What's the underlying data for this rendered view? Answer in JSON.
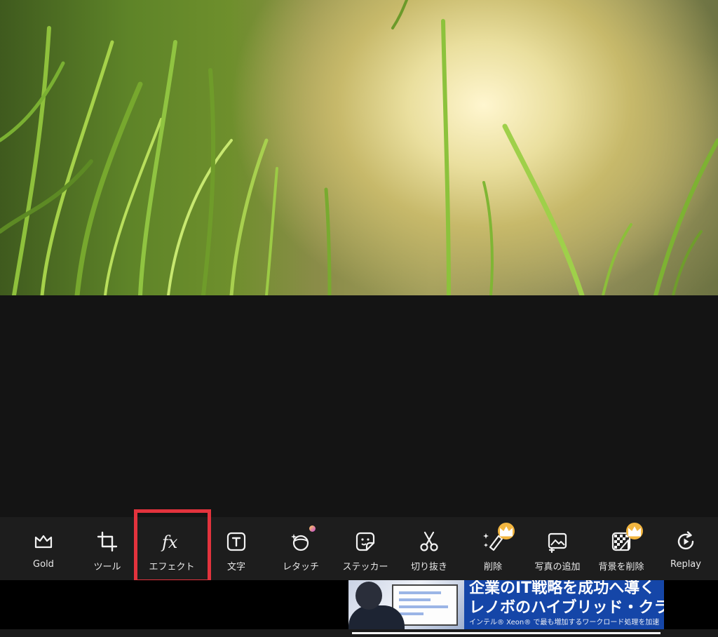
{
  "toolbar": {
    "tools": [
      {
        "id": "gold",
        "label": "Gold",
        "icon": "crown-icon"
      },
      {
        "id": "tools",
        "label": "ツール",
        "icon": "crop-icon"
      },
      {
        "id": "effects",
        "label": "エフェクト",
        "icon": "fx-icon",
        "highlighted": true
      },
      {
        "id": "text",
        "label": "文字",
        "icon": "text-box-icon"
      },
      {
        "id": "retouch",
        "label": "レタッチ",
        "icon": "retouch-face-icon"
      },
      {
        "id": "sticker",
        "label": "ステッカー",
        "icon": "sticker-icon"
      },
      {
        "id": "cutout",
        "label": "切り抜き",
        "icon": "scissors-icon"
      },
      {
        "id": "remove",
        "label": "削除",
        "icon": "eraser-magic-icon",
        "premium": true
      },
      {
        "id": "add-photo",
        "label": "写真の追加",
        "icon": "add-photo-icon"
      },
      {
        "id": "remove-bg",
        "label": "背景を削除",
        "icon": "remove-background-icon",
        "premium": true
      },
      {
        "id": "replay",
        "label": "Replay",
        "icon": "replay-icon"
      }
    ]
  },
  "ad": {
    "line1": "企業のIT戦略を成功へ導く",
    "line2": "レノボのハイブリッド・クラウ",
    "line3": "インテル® Xeon® で最も増加するワークロード処理を加速"
  },
  "colors": {
    "toolbar_bg": "#1d1d1d",
    "highlight": "#e3333d",
    "premium_badge": "#f3b640",
    "ad_bg": "#1546a8"
  }
}
